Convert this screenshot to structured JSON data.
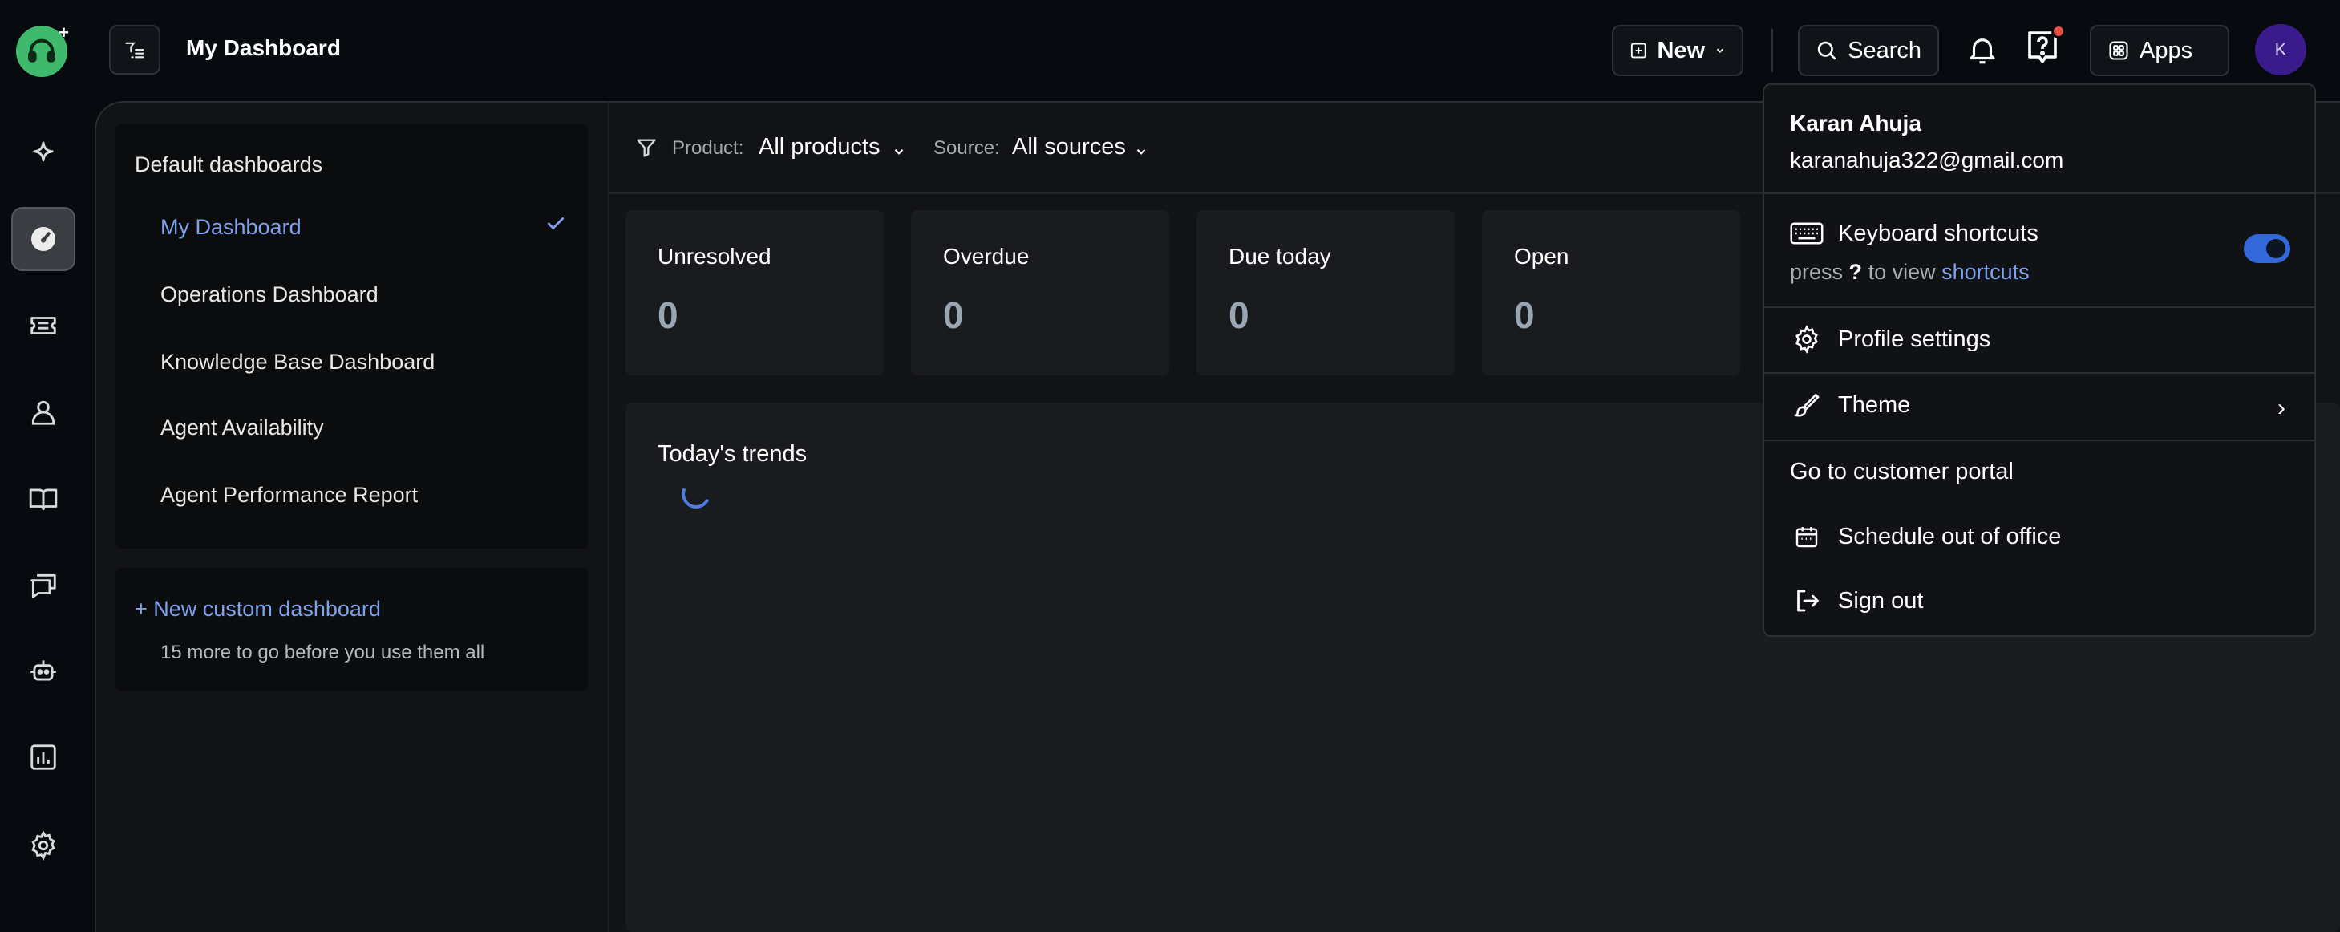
{
  "header": {
    "title": "My Dashboard",
    "new_label": "New",
    "search_label": "Search",
    "apps_label": "Apps",
    "avatar_initial": "K"
  },
  "rail": {
    "items": [
      "sparkle-icon",
      "dashboard-icon",
      "ticket-icon",
      "contacts-icon",
      "knowledge-icon",
      "conversations-icon",
      "bot-icon",
      "reports-icon",
      "settings-icon"
    ],
    "active": "dashboard-icon"
  },
  "sidebar": {
    "heading": "Default dashboards",
    "items": [
      {
        "label": "My Dashboard",
        "active": true
      },
      {
        "label": "Operations Dashboard"
      },
      {
        "label": "Knowledge Base Dashboard"
      },
      {
        "label": "Agent Availability"
      },
      {
        "label": "Agent Performance Report"
      }
    ],
    "custom_link": "+ New custom dashboard",
    "custom_note": "15 more to go before you use them all"
  },
  "filters": {
    "product_label": "Product:",
    "product_value": "All products",
    "source_label": "Source:",
    "source_value": "All sources"
  },
  "stats": [
    {
      "label": "Unresolved",
      "value": "0"
    },
    {
      "label": "Overdue",
      "value": "0"
    },
    {
      "label": "Due today",
      "value": "0"
    },
    {
      "label": "Open",
      "value": "0"
    }
  ],
  "trends": {
    "title": "Today's trends"
  },
  "menu": {
    "name": "Karan Ahuja",
    "email": "karanahuja322@gmail.com",
    "keyboard_shortcuts": "Keyboard shortcuts",
    "shortcuts_hint_prefix": "press",
    "shortcuts_hint_key": "?",
    "shortcuts_hint_middle": "to view",
    "shortcuts_hint_link": "shortcuts",
    "shortcuts_enabled": true,
    "profile_settings": "Profile settings",
    "theme": "Theme",
    "customer_portal": "Go to customer portal",
    "schedule_ooo": "Schedule out of office",
    "sign_out": "Sign out"
  },
  "colors": {
    "accent": "#7ea2ee",
    "logo": "#3fb96b",
    "avatar": "#3a1b8c",
    "notification": "#e85045",
    "toggle": "#3268d9"
  }
}
